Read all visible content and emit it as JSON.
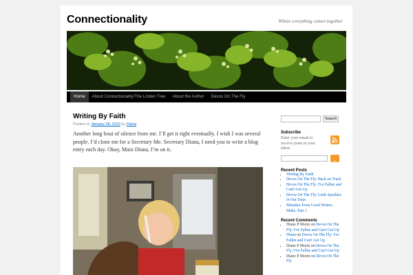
{
  "site": {
    "title": "Connectionality",
    "description": "Where everything comes together"
  },
  "nav": {
    "items": [
      {
        "label": "Home"
      },
      {
        "label": "About Connectionality/The Linden Tree"
      },
      {
        "label": "About the Author"
      },
      {
        "label": "Devos On The Fly"
      }
    ]
  },
  "post": {
    "title": "Writing By Faith",
    "meta_prefix": "Posted on",
    "date": "January 28, 2013",
    "meta_by": "by",
    "author": "Diana",
    "paragraph": "Another long bout of silence from me. I’ll get it right eventually. I wish I was several people. I’d clone me for a Secretary Me. Secretary Diana, I need you to write a blog entry each day. Okay, Main Diana, I’m on it."
  },
  "sidebar": {
    "search_button": "Search",
    "subscribe": {
      "title": "Subscribe",
      "text": "Enter your email to receive posts in your inbox",
      "ok_label": "Ok"
    },
    "recent_posts": {
      "title": "Recent Posts",
      "items": [
        "Writing By Faith",
        "Devos On The Fly: Back on Track",
        "Devos On The Fly: I've Fallen and Can't Get Up",
        "Devos On The Fly: Little Sparkles in Our Days",
        "Mistakes Even Good Writers Make, Part 1"
      ]
    },
    "recent_comments": {
      "title": "Recent Comments",
      "items": [
        {
          "author": "Diane P Morin",
          "on": "on",
          "post": "Devos On The Fly: I've Fallen and Can't Get Up"
        },
        {
          "author": "Diana",
          "on": "on",
          "post": "Devos On The Fly: I've Fallen and Can't Get Up"
        },
        {
          "author": "Diane P Morin",
          "on": "on",
          "post": "Devos On The Fly: I've Fallen and Can't Get Up"
        },
        {
          "author": "Diane P Morin",
          "on": "on",
          "post": "Devos On The Fly"
        }
      ]
    }
  },
  "icons": {
    "rss": "rss-icon",
    "ok": "ok-button"
  },
  "colors": {
    "link": "#0066cc",
    "nav_bg": "#000000",
    "rss_orange": "#f39c2b"
  }
}
